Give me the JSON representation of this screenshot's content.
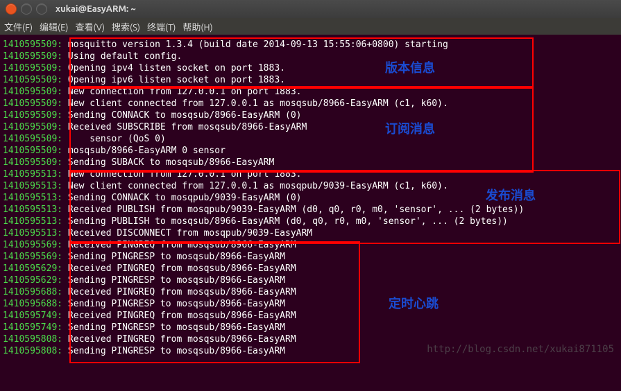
{
  "window": {
    "title": "xukai@EasyARM: ~"
  },
  "menu": {
    "file": "文件(F)",
    "edit": "编辑(E)",
    "view": "查看(V)",
    "search": "搜索(S)",
    "terminal": "终端(T)",
    "help": "帮助(H)"
  },
  "lines": [
    {
      "ts": "1410595509:",
      "txt": " mosquitto version 1.3.4 (build date 2014-09-13 15:55:06+0800) starting"
    },
    {
      "ts": "1410595509:",
      "txt": " Using default config."
    },
    {
      "ts": "1410595509:",
      "txt": " Opening ipv4 listen socket on port 1883."
    },
    {
      "ts": "1410595509:",
      "txt": " Opening ipv6 listen socket on port 1883."
    },
    {
      "ts": "1410595509:",
      "txt": " New connection from 127.0.0.1 on port 1883."
    },
    {
      "ts": "1410595509:",
      "txt": " New client connected from 127.0.0.1 as mosqsub/8966-EasyARM (c1, k60)."
    },
    {
      "ts": "1410595509:",
      "txt": " Sending CONNACK to mosqsub/8966-EasyARM (0)"
    },
    {
      "ts": "1410595509:",
      "txt": " Received SUBSCRIBE from mosqsub/8966-EasyARM"
    },
    {
      "ts": "1410595509:",
      "txt": "     sensor (QoS 0)"
    },
    {
      "ts": "1410595509:",
      "txt": " mosqsub/8966-EasyARM 0 sensor"
    },
    {
      "ts": "1410595509:",
      "txt": " Sending SUBACK to mosqsub/8966-EasyARM"
    },
    {
      "ts": "1410595513:",
      "txt": " New connection from 127.0.0.1 on port 1883."
    },
    {
      "ts": "1410595513:",
      "txt": " New client connected from 127.0.0.1 as mosqpub/9039-EasyARM (c1, k60)."
    },
    {
      "ts": "1410595513:",
      "txt": " Sending CONNACK to mosqpub/9039-EasyARM (0)"
    },
    {
      "ts": "1410595513:",
      "txt": " Received PUBLISH from mosqpub/9039-EasyARM (d0, q0, r0, m0, 'sensor', ... (2 bytes))"
    },
    {
      "ts": "1410595513:",
      "txt": " Sending PUBLISH to mosqsub/8966-EasyARM (d0, q0, r0, m0, 'sensor', ... (2 bytes))"
    },
    {
      "ts": "1410595513:",
      "txt": " Received DISCONNECT from mosqpub/9039-EasyARM"
    },
    {
      "ts": "1410595569:",
      "txt": " Received PINGREQ from mosqsub/8966-EasyARM"
    },
    {
      "ts": "1410595569:",
      "txt": " Sending PINGRESP to mosqsub/8966-EasyARM"
    },
    {
      "ts": "1410595629:",
      "txt": " Received PINGREQ from mosqsub/8966-EasyARM"
    },
    {
      "ts": "1410595629:",
      "txt": " Sending PINGRESP to mosqsub/8966-EasyARM"
    },
    {
      "ts": "1410595688:",
      "txt": " Received PINGREQ from mosqsub/8966-EasyARM"
    },
    {
      "ts": "1410595688:",
      "txt": " Sending PINGRESP to mosqsub/8966-EasyARM"
    },
    {
      "ts": "1410595749:",
      "txt": " Received PINGREQ from mosqsub/8966-EasyARM"
    },
    {
      "ts": "1410595749:",
      "txt": " Sending PINGRESP to mosqsub/8966-EasyARM"
    },
    {
      "ts": "1410595808:",
      "txt": " Received PINGREQ from mosqsub/8966-EasyARM"
    },
    {
      "ts": "1410595808:",
      "txt": " Sending PINGRESP to mosqsub/8966-EasyARM"
    }
  ],
  "annotations": {
    "a1": "版本信息",
    "a2": "订阅消息",
    "a3": "发布消息",
    "a4": "定时心跳"
  },
  "watermark": "http://blog.csdn.net/xukai871105"
}
